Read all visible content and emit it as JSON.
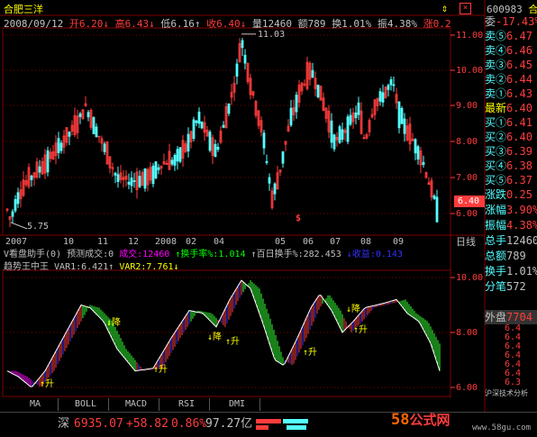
{
  "stock": {
    "name": "合肥三洋",
    "code": "600983",
    "code_suffix": "合"
  },
  "quote": {
    "date": "2008/09/12",
    "open_label": "开",
    "open": "6.20",
    "open_arrow": "↓",
    "high_label": "高",
    "high": "6.43",
    "high_arrow": "↓",
    "low_label": "低",
    "low": "6.16",
    "low_arrow": "↑",
    "close_label": "收",
    "close": "6.40",
    "close_arrow": "↓",
    "vol_label": "量",
    "vol": "12460",
    "amt_label": "额",
    "amt": "789",
    "turn_label": "换",
    "turn": "1.01%",
    "amp_label": "振",
    "amp": "4.38%",
    "chg_label": "涨",
    "chg": "0.2"
  },
  "main_chart": {
    "y_ticks": [
      "11.00",
      "10.00",
      "9.00",
      "8.00",
      "7.00",
      "6.00"
    ],
    "high_annot": "11.03",
    "low_annot": "5.75",
    "price_tag": "6.40",
    "x_ticks": [
      "2007",
      "10",
      "11",
      "12",
      "2008",
      "02",
      "04",
      "05",
      "06",
      "07",
      "08",
      "09"
    ],
    "period_label": "日线"
  },
  "indicator_bar": {
    "line1": "V看盘助手(0) 预测成交:0",
    "vol_part": "成交:12460",
    "turn_part": "↑换手率%:1.014",
    "turn100": "↑百日换手%:282.453",
    "profit": "↓收益:0.143",
    "line2_name": "趋势王中王",
    "var1": "VAR1:6.421",
    "var1_arrow": "↑",
    "var2": "VAR2:7.761",
    "var2_arrow": "↓"
  },
  "sub_chart": {
    "y_ticks": [
      "10.00",
      "8.00",
      "6.00"
    ],
    "signals_up": [
      "↑升",
      "↑升",
      "↑升",
      "↑升",
      "↑升"
    ],
    "signals_down": [
      "↓降",
      "↓降",
      "↓降"
    ]
  },
  "tabs": [
    "MA",
    "BOLL",
    "MACD",
    "RSI",
    "DMI"
  ],
  "orderbook": {
    "ratio": "-17.43%",
    "sells": [
      {
        "label": "卖⑤",
        "price": "6.47"
      },
      {
        "label": "卖④",
        "price": "6.46"
      },
      {
        "label": "卖③",
        "price": "6.45"
      },
      {
        "label": "卖②",
        "price": "6.44"
      },
      {
        "label": "卖①",
        "price": "6.43"
      }
    ],
    "last": {
      "label": "最新",
      "price": "6.40"
    },
    "buys": [
      {
        "label": "买①",
        "price": "6.41"
      },
      {
        "label": "买②",
        "price": "6.40"
      },
      {
        "label": "买③",
        "price": "6.39"
      },
      {
        "label": "买④",
        "price": "6.38"
      },
      {
        "label": "买⑤",
        "price": "6.37"
      }
    ],
    "stats": [
      {
        "label": "涨跌",
        "value": "0.25"
      },
      {
        "label": "涨幅",
        "value": "3.90%"
      },
      {
        "label": "振幅",
        "value": "4.38%"
      },
      {
        "label": "总手",
        "value": "12460"
      },
      {
        "label": "总额",
        "value": "789"
      },
      {
        "label": "换手",
        "value": "1.01%"
      },
      {
        "label": "分笔",
        "value": "572"
      }
    ],
    "outer_label": "外盘",
    "outer_value": "7704",
    "ticks": [
      "6.4",
      "6.4",
      "6.4",
      "6.4",
      "6.4",
      "6.4",
      "6.3"
    ],
    "tick_label": "沪深技术分析"
  },
  "statusbar": {
    "market": "深",
    "index": "6935.07",
    "change": "+58.82",
    "pct": "0.86%",
    "amount": "97.27亿",
    "watermark_num": "58",
    "watermark_text": "公式网",
    "watermark_url": "www.58gu.com"
  },
  "colors": {
    "up": "#ff3c3c",
    "down": "#54ffff",
    "yellow": "#ffff00",
    "white": "#ffffff",
    "grid": "#800000",
    "axis": "#c0c0c0",
    "magenta": "#ff00ff",
    "green": "#00ff00",
    "blue": "#3333ff"
  },
  "chart_data": {
    "type": "candlestick",
    "price_axis_range": [
      5.7,
      11.4
    ],
    "high": 11.03,
    "low": 5.75,
    "last_close": 6.4
  }
}
